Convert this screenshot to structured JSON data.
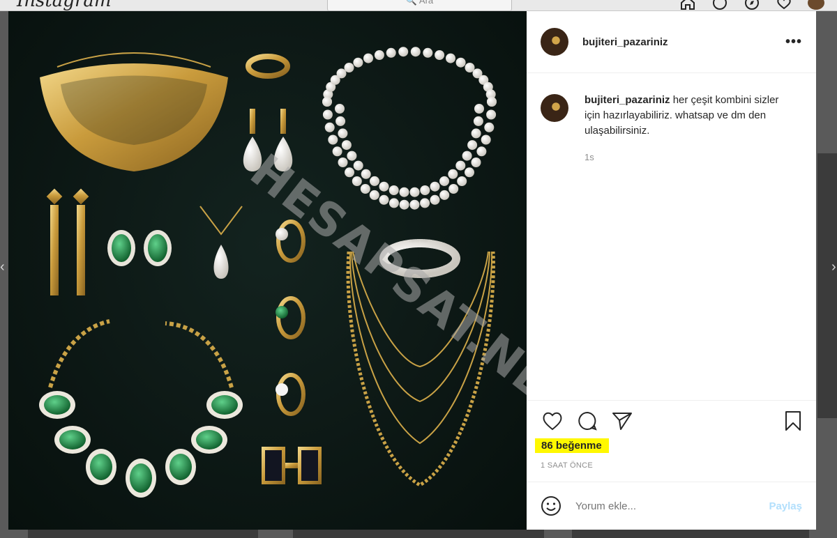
{
  "background": {
    "logo": "Instagram",
    "search_placeholder": "Ara"
  },
  "post": {
    "username": "bujiteri_pazariniz",
    "more_label": "•••",
    "caption": {
      "username": "bujiteri_pazariniz",
      "text": "her çeşit kombini sizler için hazırlayabiliriz. whatsap ve dm den ulaşabilirsiniz.",
      "time": "1s"
    },
    "likes": "86 beğenme",
    "posted_ago": "1 SAAT ÖNCE",
    "comment_placeholder": "Yorum ekle...",
    "post_button": "Paylaş",
    "watermark": "HESAPSAT.NET"
  },
  "colors": {
    "like_highlight": "#fff800",
    "post_button": "#b2dffc",
    "photo_bg": "#0c1714",
    "gold": "#c9a246",
    "emerald": "#1d7a3e"
  }
}
